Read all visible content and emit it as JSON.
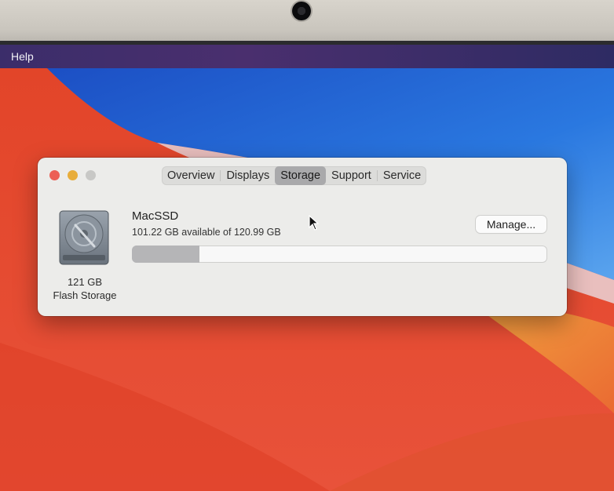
{
  "menubar": {
    "help_label": "Help"
  },
  "window": {
    "tabs": [
      {
        "label": "Overview",
        "selected": false
      },
      {
        "label": "Displays",
        "selected": false
      },
      {
        "label": "Storage",
        "selected": true
      },
      {
        "label": "Support",
        "selected": false
      },
      {
        "label": "Service",
        "selected": false
      }
    ],
    "disk": {
      "size_label": "121 GB",
      "type_label": "Flash Storage",
      "icon": "hard-drive-icon"
    },
    "volume": {
      "name": "MacSSD",
      "available_text": "101.22 GB available of 120.99 GB",
      "used_fraction": 0.163
    },
    "manage_label": "Manage..."
  },
  "colors": {
    "wallpaper_red": "#e8452c",
    "wallpaper_blue": "#1f5fd0",
    "window_bg": "#ececea",
    "close": "#ec5f55",
    "minimize": "#e8ad3b"
  }
}
